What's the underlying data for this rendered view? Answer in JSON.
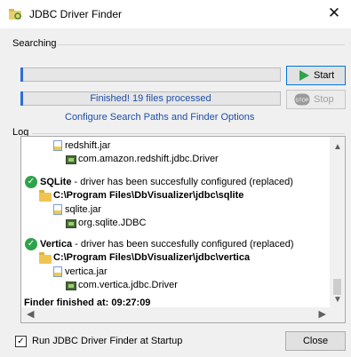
{
  "window": {
    "title": "JDBC Driver Finder",
    "close_glyph": "✕",
    "icon": "jdbc-finder-icon"
  },
  "searching": {
    "group_label": "Searching",
    "progress_top": {
      "value_percent": 0,
      "text": ""
    },
    "progress_bottom": {
      "value_percent": 0,
      "text": "Finished! 19 files processed"
    },
    "start_label": "Start",
    "stop_label": "Stop",
    "stop_badge": "STOP",
    "configure_link": "Configure Search Paths and Finder Options"
  },
  "log": {
    "group_label": "Log",
    "lines": {
      "redshift_file": "redshift.jar",
      "redshift_class": "com.amazon.redshift.jdbc.Driver",
      "sqlite_name": "SQLite",
      "sqlite_status": " - driver has been succesfully configured (replaced)",
      "sqlite_path": "C:\\Program Files\\DbVisualizer\\jdbc\\sqlite",
      "sqlite_file": "sqlite.jar",
      "sqlite_class": "org.sqlite.JDBC",
      "vertica_name": "Vertica",
      "vertica_status": " - driver has been succesfully configured (replaced)",
      "vertica_path": "C:\\Program Files\\DbVisualizer\\jdbc\\vertica",
      "vertica_file": "vertica.jar",
      "vertica_class": "com.vertica.jdbc.Driver",
      "finished": "Finder finished at: 09:27:09"
    }
  },
  "footer": {
    "startup_checkbox_label": "Run JDBC Driver Finder at Startup",
    "startup_checked": true,
    "check_glyph": "✓",
    "close_label": "Close"
  },
  "colors": {
    "accent": "#0078d7",
    "link": "#1f4ea8",
    "start_arrow": "#2fa34a",
    "success": "#2fa34a"
  }
}
